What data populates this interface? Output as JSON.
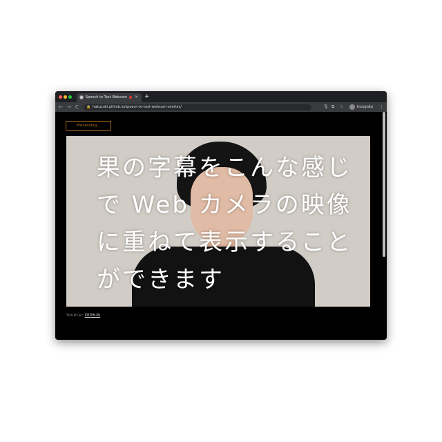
{
  "browser": {
    "tab_title": "Speech to Text Webcam O",
    "tab_close": "×",
    "new_tab": "+",
    "nav_back": "←",
    "nav_forward": "→",
    "nav_reload": "C",
    "lock": "🔒",
    "url": "hakuzuki.github.io/speech-to-text-webcam-overlay/",
    "mic": "🎙",
    "translate": "⧉",
    "star": "☆",
    "incognito_label": "Incognito",
    "menu": "⋮"
  },
  "page": {
    "status_button": "Processing...",
    "subtitle_text": "果の字幕をこんな感じで Web カメラの映像に重ねて表示することができます",
    "source_prefix": "Source: ",
    "source_link": "GitHub"
  },
  "colors": {
    "page_bg": "#000000",
    "accent": "#c07a2a",
    "record_dot": "#e53935"
  }
}
